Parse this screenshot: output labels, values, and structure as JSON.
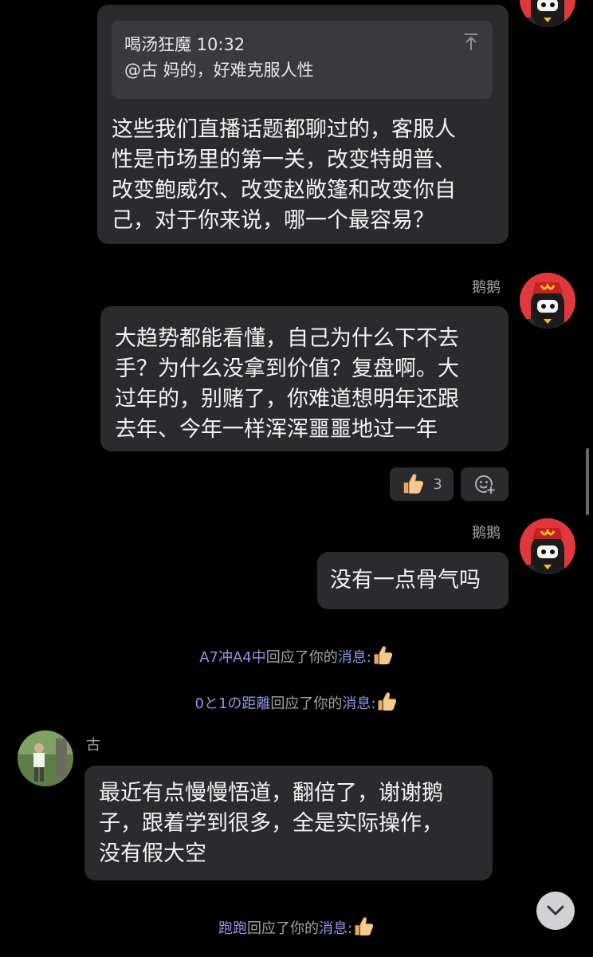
{
  "messages": {
    "m1": {
      "quote_author_time": "喝汤狂魔 10:32",
      "quote_text": "@古 妈的，好难克服人性",
      "lines": [
        "这些我们直播话题都聊过的，客服人",
        "性是市场里的第一关，改变特朗普、",
        "改变鲍威尔、改变赵敞篷和改变你自",
        "己，对于你来说，哪一个最容易？"
      ]
    },
    "m2": {
      "sender": "鹅鹅",
      "lines": [
        "大趋势都能看懂，自己为什么下不去",
        "手？为什么没拿到价值？复盘啊。大",
        "过年的，别赌了，你难道想明年还跟",
        "去年、今年一样浑浑噩噩地过一年"
      ],
      "reaction_count": "3"
    },
    "m3": {
      "sender": "鹅鹅",
      "text": "没有一点骨气吗"
    },
    "sys1": {
      "user": "A7冲A4中",
      "mid": "回应了你的",
      "link": "消息",
      "colon": ":"
    },
    "sys2": {
      "user": "0と1の距離",
      "mid": "回应了你的",
      "link": "消息",
      "colon": ":"
    },
    "m4": {
      "sender": "古",
      "lines": [
        "最近有点慢慢悟道，翻倍了，谢谢鹅",
        "子，跟着学到很多，全是实际操作，",
        "没有假大空"
      ]
    },
    "sys3": {
      "user": "跑跑",
      "mid": "回应了你的",
      "link": "消息",
      "colon": ":"
    }
  },
  "icons": {
    "thumb": "thumbs-up-icon",
    "add_reaction": "add-reaction-icon",
    "scroll_down": "chevron-down-icon",
    "pin_top": "arrow-up-to-top-icon"
  },
  "colors": {
    "bubble": "#2b2b2d",
    "quote": "#3a3a3c",
    "highlight": "#8d97e6",
    "avatar_red": "#e0393c"
  }
}
